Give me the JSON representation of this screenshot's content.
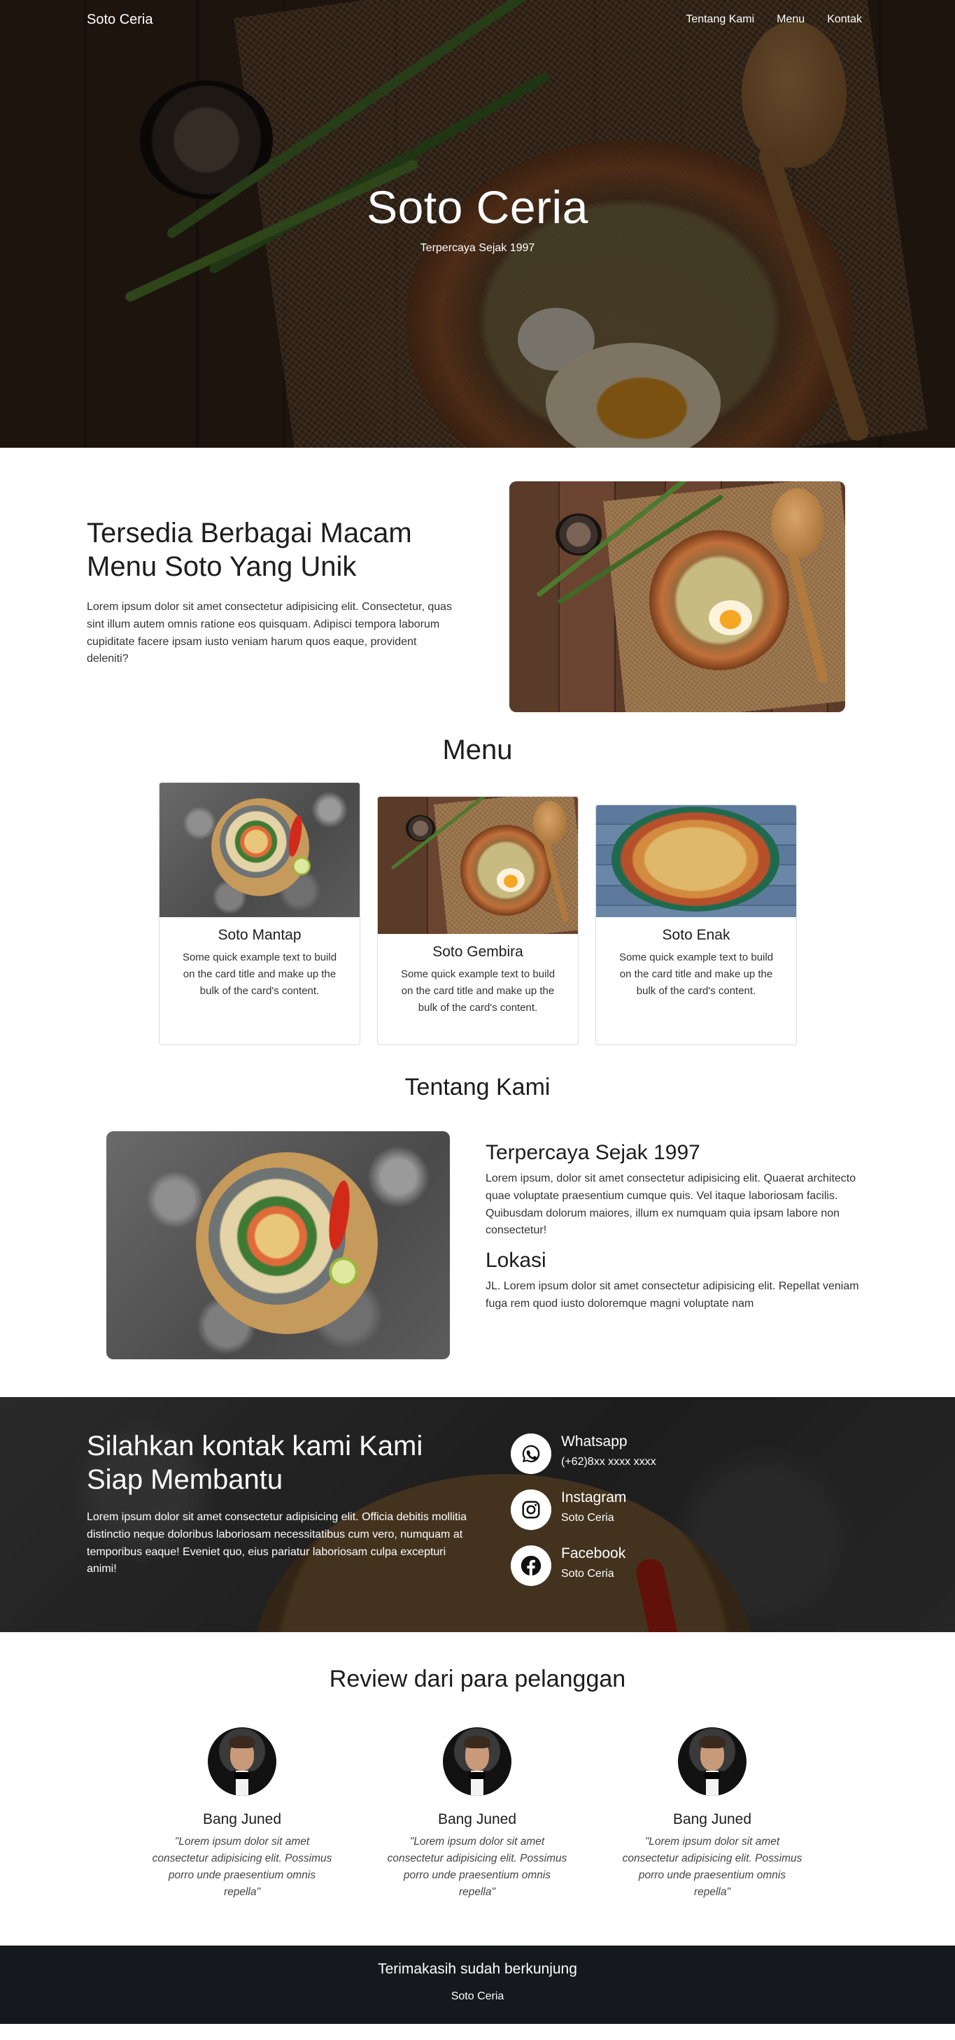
{
  "nav": {
    "brand": "Soto Ceria",
    "links": [
      "Tentang Kami",
      "Menu",
      "Kontak"
    ]
  },
  "hero": {
    "title": "Soto Ceria",
    "subtitle": "Terpercaya Sejak 1997"
  },
  "intro": {
    "heading": "Tersedia Berbagai Macam Menu Soto Yang Unik",
    "text": "Lorem ipsum dolor sit amet consectetur adipisicing elit. Consectetur, quas sint illum autem omnis ratione eos quisquam. Adipisci tempora laborum cupiditate facere ipsam iusto veniam harum quos eaque, provident deleniti?"
  },
  "menu": {
    "title": "Menu",
    "cards": [
      {
        "title": "Soto Mantap",
        "text": "Some quick example text to build on the card title and make up the bulk of the card's content."
      },
      {
        "title": "Soto Gembira",
        "text": "Some quick example text to build on the card title and make up the bulk of the card's content."
      },
      {
        "title": "Soto Enak",
        "text": "Some quick example text to build on the card title and make up the bulk of the card's content."
      }
    ]
  },
  "about": {
    "title": "Tentang Kami",
    "heading1": "Terpercaya Sejak 1997",
    "text1": "Lorem ipsum, dolor sit amet consectetur adipisicing elit. Quaerat architecto quae voluptate praesentium cumque quis. Vel itaque laboriosam facilis. Quibusdam dolorum maiores, illum ex numquam quia ipsam labore non consectetur!",
    "heading2": "Lokasi",
    "text2": "JL. Lorem ipsum dolor sit amet consectetur adipisicing elit. Repellat veniam fuga rem quod iusto doloremque magni voluptate nam"
  },
  "contact": {
    "heading": "Silahkan kontak kami Kami Siap Membantu",
    "text": "Lorem ipsum dolor sit amet consectetur adipisicing elit. Officia debitis mollitia distinctio neque doloribus laboriosam necessitatibus cum vero, numquam at temporibus eaque! Eveniet quo, eius pariatur laboriosam culpa excepturi animi!",
    "items": [
      {
        "title": "Whatsapp",
        "value": "(+62)8xx xxxx xxxx",
        "icon": "whatsapp-icon"
      },
      {
        "title": "Instagram",
        "value": "Soto Ceria",
        "icon": "instagram-icon"
      },
      {
        "title": "Facebook",
        "value": "Soto Ceria",
        "icon": "facebook-icon"
      }
    ]
  },
  "reviews": {
    "title": "Review dari para pelanggan",
    "items": [
      {
        "name": "Bang Juned",
        "quote": "\"Lorem ipsum dolor sit amet consectetur adipisicing elit. Possimus porro unde praesentium omnis repella\""
      },
      {
        "name": "Bang Juned",
        "quote": "\"Lorem ipsum dolor sit amet consectetur adipisicing elit. Possimus porro unde praesentium omnis repella\""
      },
      {
        "name": "Bang Juned",
        "quote": "\"Lorem ipsum dolor sit amet consectetur adipisicing elit. Possimus porro unde praesentium omnis repella\""
      }
    ]
  },
  "footer": {
    "thanks": "Terimakasih sudah berkunjung",
    "brand": "Soto Ceria"
  },
  "colors": {
    "footer_bg": "#15181c",
    "text_dark": "#1d1d1d",
    "white": "#ffffff"
  }
}
